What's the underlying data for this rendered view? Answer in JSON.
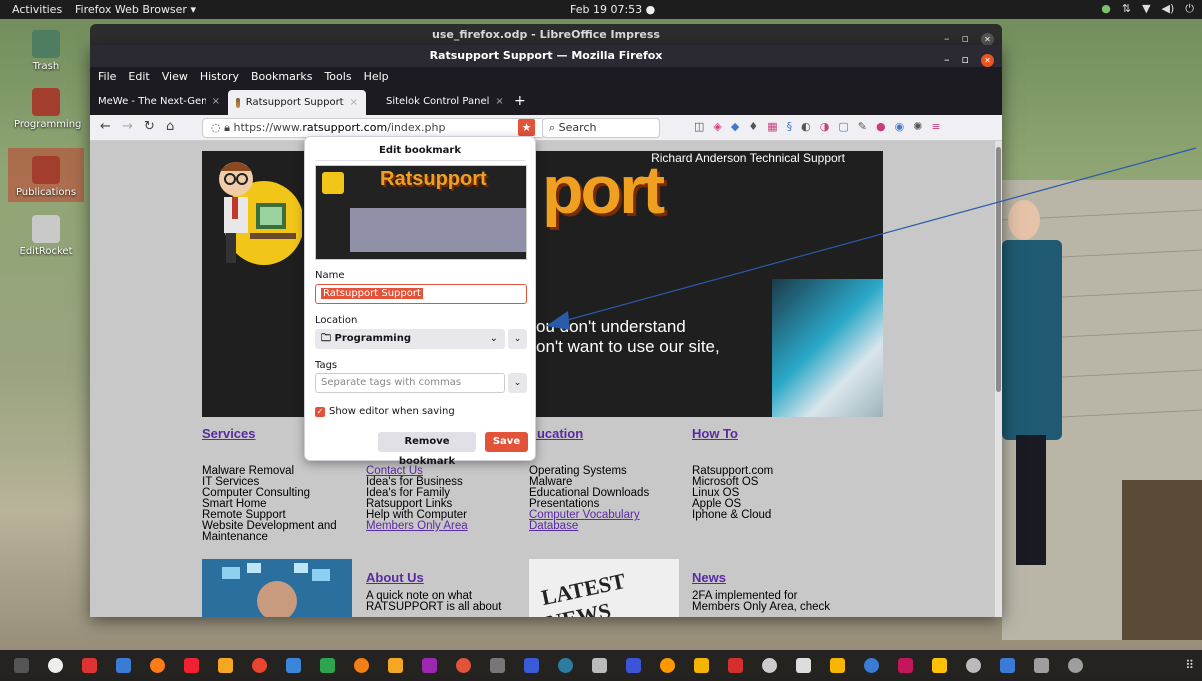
{
  "topbar": {
    "activities": "Activities",
    "app": "Firefox Web Browser ▾",
    "clock": "Feb 19  07:53  ●"
  },
  "desktop": {
    "icons": [
      {
        "label": "Trash"
      },
      {
        "label": "Programming"
      },
      {
        "label": "Publications"
      },
      {
        "label": "EditRocket"
      }
    ]
  },
  "impress": {
    "title": "use_firefox.odp - LibreOffice Impress"
  },
  "firefox": {
    "title": "Ratsupport Support — Mozilla Firefox",
    "menu": [
      "File",
      "Edit",
      "View",
      "History",
      "Bookmarks",
      "Tools",
      "Help"
    ],
    "tabs": [
      {
        "label": "MeWe - The Next-Gen Social",
        "close": "×"
      },
      {
        "label": "Ratsupport Support",
        "close": "×"
      },
      {
        "label": "Sitelok Control Panel",
        "close": "×"
      }
    ],
    "newtab": "+",
    "url_prefix": "https://www.",
    "url_domain": "ratsupport.com",
    "url_path": "/index.php",
    "search_placeholder": "Search"
  },
  "page": {
    "tagline": "Richard Anderson Technical Support",
    "logo": "port",
    "hero_line1": "ou don't understand",
    "hero_line2": "on't want to use our site,",
    "services": {
      "heading": "Services",
      "items": [
        "Malware Removal",
        "IT Services",
        "Computer Consulting",
        "Smart Home",
        "Remote Support",
        "Website Development and",
        "Maintenance"
      ]
    },
    "contact": {
      "items": [
        "Contact Us",
        "Idea's for Business",
        "Idea's for Family",
        "Ratsupport Links",
        "Help with Computer",
        "Members Only Area"
      ]
    },
    "education": {
      "heading": "ducation",
      "items": [
        "Operating Systems",
        "Malware",
        "Educational Downloads",
        "Presentations",
        "Computer Vocabulary",
        "Database"
      ]
    },
    "howto": {
      "heading": "How To",
      "items": [
        "Ratsupport.com",
        "Microsoft OS",
        "Linux OS",
        "Apple OS",
        "Iphone & Cloud"
      ]
    },
    "about": {
      "heading": "About Us",
      "line1": "A quick note on what",
      "line2": "RATSUPPORT is all about"
    },
    "news": {
      "heading": "News",
      "line1": "2FA implemented for",
      "line2": "Members Only Area, check"
    },
    "news_img_text": "LATEST NEWS"
  },
  "bookmark_panel": {
    "title": "Edit bookmark",
    "preview_logo": "Ratsupport",
    "name_label": "Name",
    "name_value": "Ratsupport Support",
    "location_label": "Location",
    "location_value": "Programming",
    "tags_label": "Tags",
    "tags_placeholder": "Separate tags with commas",
    "show_editor_label": "Show editor when saving",
    "remove_label": "Remove bookmark",
    "save_label": "Save"
  },
  "colors": {
    "accent": "#e2533a",
    "link": "#5a2aa0",
    "logo": "#f0a020"
  }
}
